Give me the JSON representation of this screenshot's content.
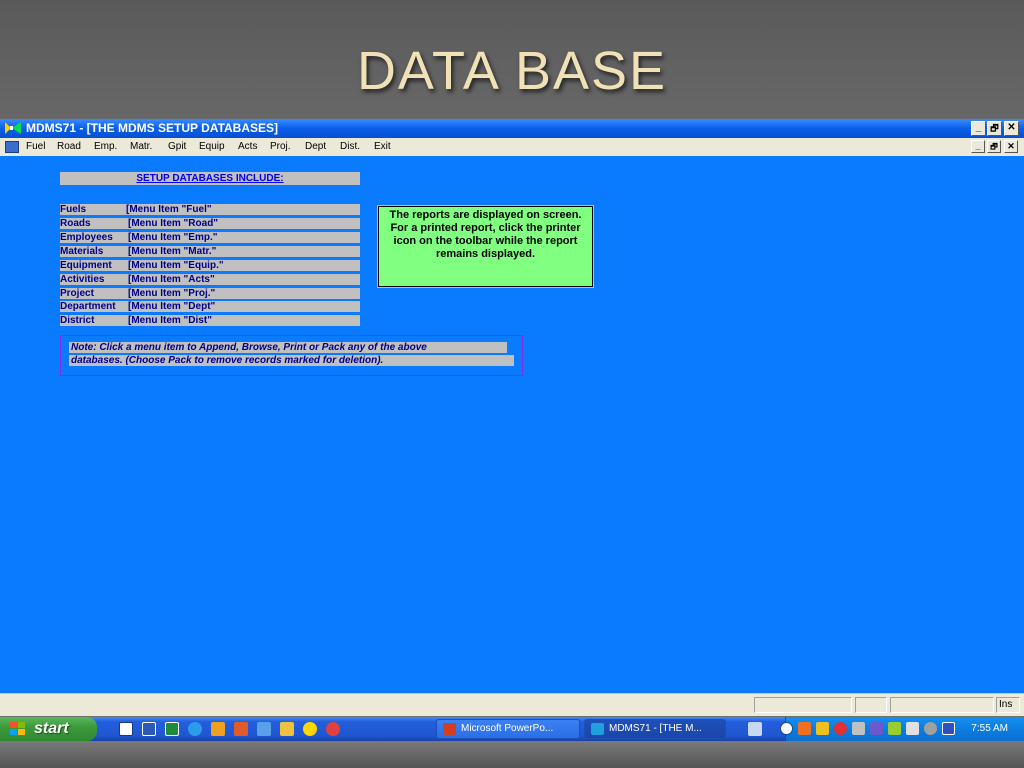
{
  "slide": {
    "title": "DATA BASE"
  },
  "window": {
    "title": "MDMS71 - [THE MDMS SETUP DATABASES]",
    "minimize": "_",
    "restore": "🗗",
    "close": "✕"
  },
  "menu": {
    "items": [
      "Fuel",
      "Road",
      "Emp.",
      "Matr.",
      "Gpit",
      "Equip",
      "Acts",
      "Proj.",
      "Dept",
      "Dist.",
      "Exit"
    ],
    "mdi_minimize": "_",
    "mdi_restore": "🗗",
    "mdi_close": "✕"
  },
  "content": {
    "header": "SETUP DATABASES INCLUDE:",
    "databases": [
      {
        "name": "Fuels",
        "menu": "[Menu Item \"Fuel\""
      },
      {
        "name": "Roads",
        "menu": "[Menu Item \"Road\""
      },
      {
        "name": "Employees",
        "menu": "[Menu Item \"Emp.\""
      },
      {
        "name": "Materials",
        "menu": "[Menu Item \"Matr.\""
      },
      {
        "name": "Equipment",
        "menu": "[Menu Item \"Equip.\""
      },
      {
        "name": "Activities",
        "menu": "[Menu Item \"Acts\""
      },
      {
        "name": "Project",
        "menu": "[Menu Item \"Proj.\""
      },
      {
        "name": "Department",
        "menu": "[Menu Item \"Dept\""
      },
      {
        "name": "District",
        "menu": "[Menu Item \"Dist\""
      }
    ],
    "info_text": "The reports are displayed on screen.  For a printed report, click the printer icon on the toolbar while the report remains displayed.",
    "note_line1": "Note: Click a menu item to Append, Browse, Print or Pack any of the above",
    "note_line2": "databases. (Choose Pack to remove records marked for deletion)."
  },
  "status": {
    "ins": "Ins"
  },
  "taskbar": {
    "start_label": "start",
    "tasks": [
      {
        "label": "Microsoft PowerPo...",
        "icon_color": "#d04020"
      },
      {
        "label": "MDMS71 - [THE M...",
        "icon_color": "#20a0e0"
      }
    ],
    "clock": "7:55 AM"
  },
  "colors": {
    "desktop_blue": "#0a7aff",
    "info_green": "#80ff80",
    "slide_title": "#f0e2b6"
  }
}
